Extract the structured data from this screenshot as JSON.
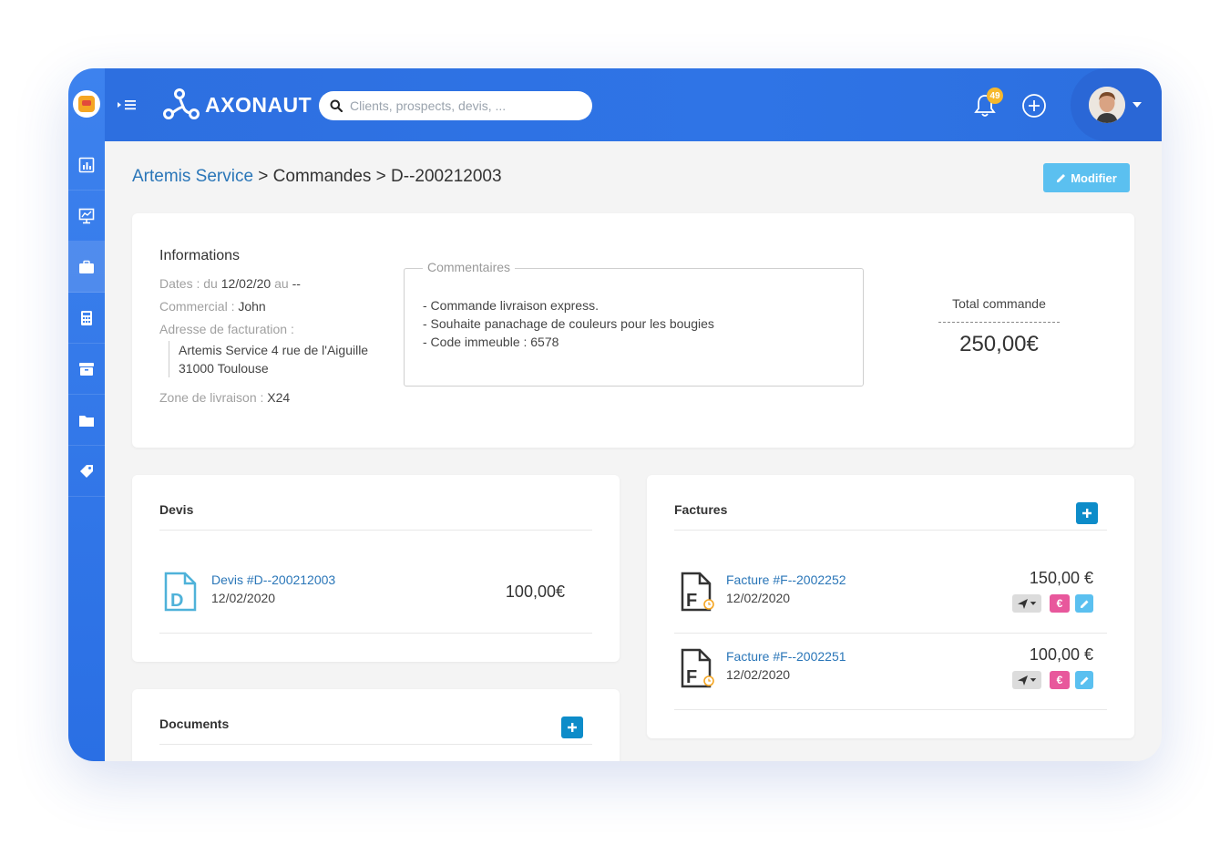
{
  "app": {
    "brand": "AXONAUT",
    "colors": {
      "primary": "#2f74e6",
      "link": "#2a76b8",
      "accent_button": "#5bc0f0",
      "add_button": "#0d8cc9",
      "payment": "#e8589c",
      "badge": "#f5b82e"
    }
  },
  "header": {
    "search_placeholder": "Clients, prospects, devis, ...",
    "notifications_count": "49",
    "icons": [
      "menu-toggle-icon",
      "search-icon",
      "bell-icon",
      "plus-circle-icon",
      "chevron-down-icon"
    ]
  },
  "sidebar": {
    "items": [
      {
        "icon": "dashboard-icon",
        "active": false
      },
      {
        "icon": "presentation-chart-icon",
        "active": false
      },
      {
        "icon": "briefcase-icon",
        "active": true
      },
      {
        "icon": "calculator-icon",
        "active": false
      },
      {
        "icon": "archive-icon",
        "active": false
      },
      {
        "icon": "folder-icon",
        "active": false
      },
      {
        "icon": "tag-icon",
        "active": false
      }
    ]
  },
  "breadcrumb": {
    "company": "Artemis Service",
    "rest": " > Commandes > D--200212003"
  },
  "toolbar": {
    "modifier_label": "Modifier"
  },
  "informations": {
    "title": "Informations",
    "dates_label": "Dates : du ",
    "dates_from": "12/02/20",
    "dates_mid": " au ",
    "dates_to": "--",
    "commercial_label": "Commercial : ",
    "commercial_value": "John",
    "billing_label": "Adresse de facturation :",
    "billing_line1": "Artemis Service 4 rue de l'Aiguille",
    "billing_line2": "31000 Toulouse",
    "delivery_label": "Zone de livraison : ",
    "delivery_value": "X24"
  },
  "comments": {
    "legend": "Commentaires",
    "lines": [
      "- Commande livraison express.",
      "- Souhaite panachage de couleurs pour les bougies",
      "- Code immeuble : 6578"
    ]
  },
  "total": {
    "label": "Total commande",
    "value": "250,00€"
  },
  "devis": {
    "title": "Devis",
    "rows": [
      {
        "link": "Devis #D--200212003",
        "date": "12/02/2020",
        "amount": "100,00€"
      }
    ]
  },
  "factures": {
    "title": "Factures",
    "rows": [
      {
        "link": "Facture #F--2002252",
        "date": "12/02/2020",
        "amount": "150,00 €",
        "pay_symbol": "€"
      },
      {
        "link": "Facture #F--2002251",
        "date": "12/02/2020",
        "amount": "100,00 €",
        "pay_symbol": "€"
      }
    ]
  },
  "documents": {
    "title": "Documents"
  }
}
